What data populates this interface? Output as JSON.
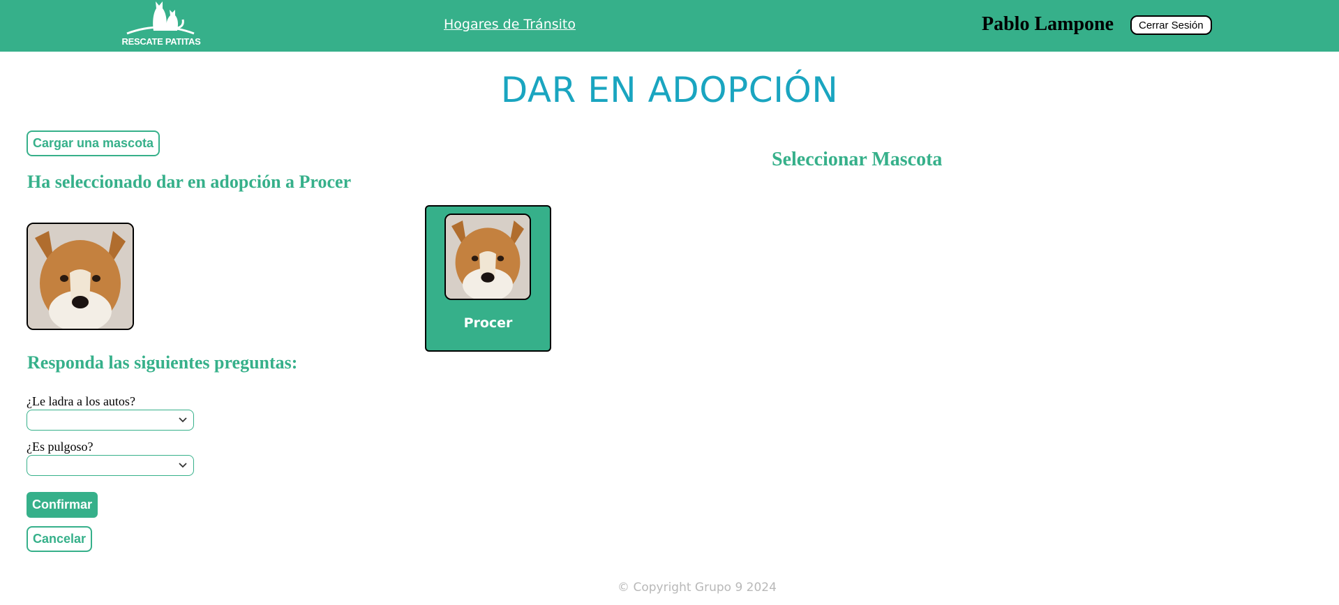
{
  "header": {
    "logo_text": "RESCATE PATITAS",
    "nav_link": "Hogares de Tránsito",
    "user_name": "Pablo Lampone",
    "logout_label": "Cerrar Sesión"
  },
  "page_title": "DAR EN ADOPCIÓN",
  "left": {
    "upload_button": "Cargar una mascota",
    "selected_heading": "Ha seleccionado dar en adopción a Procer",
    "questions_heading": "Responda las siguientes preguntas:",
    "questions": [
      {
        "label": "¿Le ladra a los autos?",
        "value": ""
      },
      {
        "label": "¿Es pulgoso?",
        "value": ""
      }
    ],
    "confirm_button": "Confirmar",
    "cancel_button": "Cancelar"
  },
  "right": {
    "select_heading": "Seleccionar Mascota",
    "pets": [
      {
        "name": "Procer",
        "photo": "collie-dog-photo"
      }
    ]
  },
  "footer": {
    "copyright": "© Copyright Grupo 9 2024"
  },
  "colors": {
    "brand_green": "#36b08a",
    "title_blue": "#1aa5c0",
    "footer_gray": "#b8b8b8"
  }
}
